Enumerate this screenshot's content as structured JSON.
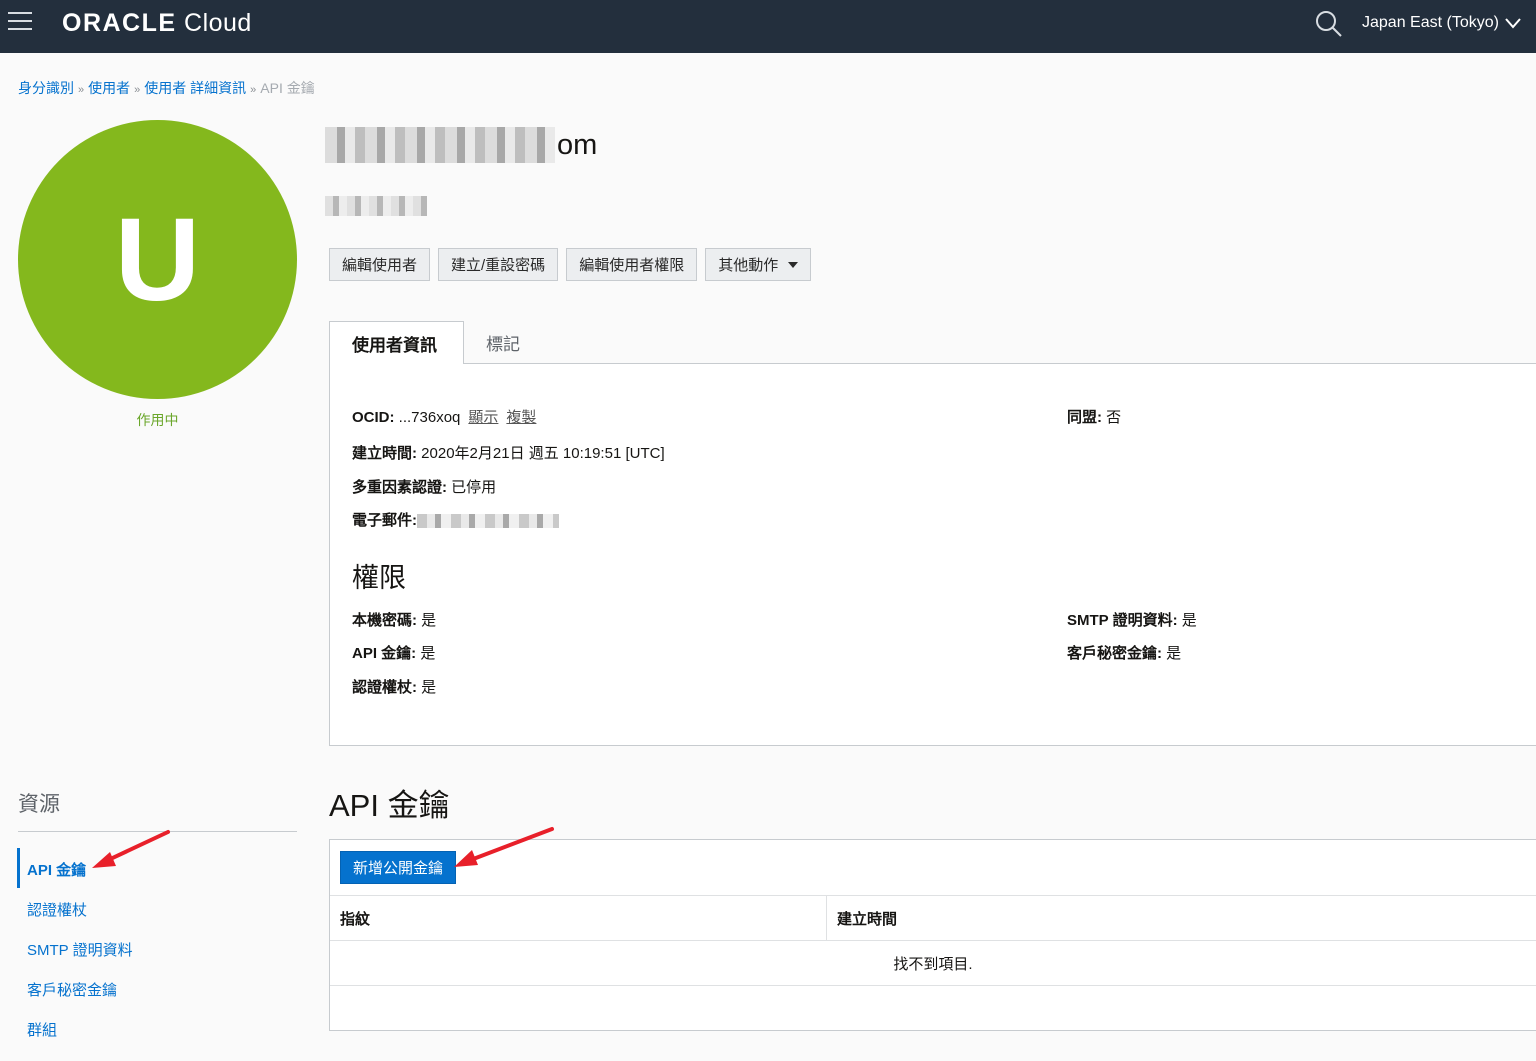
{
  "topbar": {
    "brand_oracle": "ORACLE",
    "brand_cloud": " Cloud",
    "region": "Japan East (Tokyo)"
  },
  "breadcrumb": {
    "items": [
      "身分識別",
      "使用者",
      "使用者 詳細資訊"
    ],
    "separator": "»",
    "current": "API 金鑰"
  },
  "avatar": {
    "letter": "U",
    "status": "作用中",
    "color": "#84b81d"
  },
  "user": {
    "name_visible_suffix": "om"
  },
  "actions": {
    "edit_user": "編輯使用者",
    "reset_password": "建立/重設密碼",
    "edit_capabilities": "編輯使用者權限",
    "more_actions": "其他動作"
  },
  "tabs": {
    "user_info": "使用者資訊",
    "tags": "標記"
  },
  "info": {
    "ocid_label": "OCID:",
    "ocid_value": " ...736xoq",
    "show": "顯示",
    "copy": "複製",
    "created_label": "建立時間:",
    "created_value": " 2020年2月21日 週五 10:19:51 [UTC]",
    "mfa_label": "多重因素認證:",
    "mfa_value": " 已停用",
    "email_label": "電子郵件:",
    "federated_label": "同盟:",
    "federated_value": " 否"
  },
  "capabilities": {
    "title": "權限",
    "local_password_label": "本機密碼:",
    "local_password_value": " 是",
    "api_keys_label": "API 金鑰:",
    "api_keys_value": " 是",
    "auth_tokens_label": "認證權杖:",
    "auth_tokens_value": " 是",
    "smtp_label": "SMTP 證明資料:",
    "smtp_value": " 是",
    "customer_secret_label": "客戶秘密金鑰:",
    "customer_secret_value": " 是"
  },
  "resources": {
    "title": "資源",
    "items": [
      "API 金鑰",
      "認證權杖",
      "SMTP 證明資料",
      "客戶秘密金鑰",
      "群組"
    ]
  },
  "api_keys": {
    "title": "API 金鑰",
    "add_button": "新增公開金鑰",
    "columns": [
      "指紋",
      "建立時間"
    ],
    "empty_message": "找不到項目."
  },
  "colors": {
    "accent": "#0572ce",
    "topbar": "#232f3d",
    "annotation_arrow": "#e8202a"
  }
}
